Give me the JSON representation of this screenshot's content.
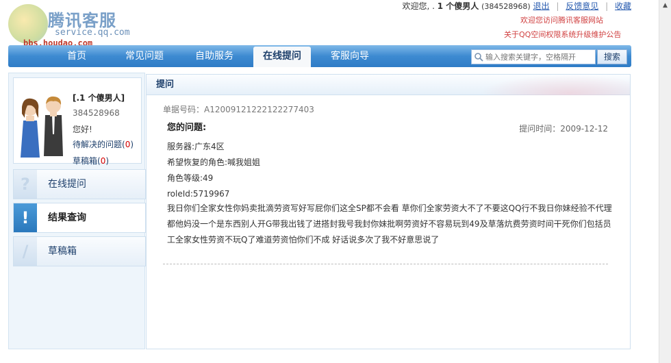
{
  "logo": {
    "brand": "腾讯客服",
    "domain": "service.qq.com",
    "watermark": "bbs.houdao.com"
  },
  "topbar": {
    "greeting": "欢迎您, .",
    "user_name": "1 个傻男人",
    "user_qq": "(384528968)",
    "logout": "退出",
    "feedback": "反馈意见",
    "favorite": "收藏"
  },
  "notices": [
    "欢迎您访问腾讯客服网站",
    "关于QQ空间权限系统升级维护公告"
  ],
  "nav": {
    "items": [
      "首页",
      "常见问题",
      "自助服务",
      "在线提问",
      "客服向导"
    ],
    "active": "在线提问"
  },
  "search": {
    "placeholder": "输入搜索关键字，空格隔开",
    "button": "搜索"
  },
  "profile": {
    "name": "[.1 个傻男人]",
    "qq": "384528968",
    "greeting": "您好!",
    "pending_label": "待解决的问题(",
    "pending_count": "0",
    "draft_label": "草稿箱(",
    "draft_count": "0",
    "close_paren": ")"
  },
  "sidebar": {
    "items": [
      {
        "label": "在线提问",
        "icon": "?"
      },
      {
        "label": "结果查询",
        "icon": "!"
      },
      {
        "label": "草稿箱",
        "icon": "/"
      }
    ]
  },
  "main": {
    "header": "提问",
    "ticket": "单据号码：A12009121222122277403",
    "question_title": "您的问题:",
    "question_time": "提问时间：2009-12-12",
    "lines": [
      "服务器:广东4区",
      "希望恢复的角色:喊我姐姐",
      "角色等级:49",
      "roleId:5719967"
    ],
    "body": "我日你们全家女性你妈卖批滴劳资写好写屁你们这全SP都不会看 草你们全家劳资大不了不要这QQ行不我日你妹经验不代理都他妈没一个是东西别人开G带我出钱了进搭封我号我封你妹批啊劳资好不容易玩到49及草落炕费劳资时间干死你们包括员工全家女性劳资不玩Q了难道劳资怕你们不成  好话说多次了我不好意思说了"
  },
  "colors": {
    "nav": "#3d8ad1",
    "accent_red": "#d40000",
    "link": "#2a5db0"
  }
}
